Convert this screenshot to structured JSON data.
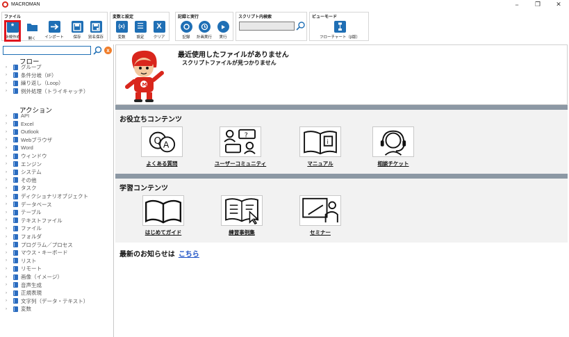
{
  "window": {
    "title": "MACROMAN",
    "buttons": {
      "minimize": "−",
      "maximize": "❐",
      "close": "✕"
    }
  },
  "ribbon": {
    "file_group": {
      "label": "ファイル",
      "buttons": [
        "新規作成",
        "開く",
        "インポート",
        "保存",
        "別名保存"
      ]
    },
    "vars_group": {
      "label": "変数と設定",
      "buttons": [
        "変数",
        "設定",
        "クリア"
      ]
    },
    "record_group": {
      "label": "記録と実行",
      "buttons": [
        "記録",
        "計画実行",
        "実行"
      ]
    },
    "search_group": {
      "label": "スクリプト内検索",
      "value": ""
    },
    "view_group": {
      "label": "ビューモード",
      "button": "フローチャート（β版）"
    },
    "icons": {
      "new": "*",
      "vars": "{x}",
      "settings": "☰",
      "clear": "X"
    }
  },
  "tree": {
    "search_value": "",
    "clear_icon": "x",
    "flow_title": "フロー",
    "flow_items": [
      "グループ",
      "条件分岐（IF）",
      "繰り返し（Loop）",
      "例外処理（トライキャッチ）"
    ],
    "action_title": "アクション",
    "action_items": [
      "API",
      "Excel",
      "Outlook",
      "Webブラウザ",
      "Word",
      "ウィンドウ",
      "エンジン",
      "システム",
      "その他",
      "タスク",
      "ディクショナリオブジェクト",
      "データベース",
      "テーブル",
      "テキストファイル",
      "ファイル",
      "フォルダ",
      "プログラム／プロセス",
      "マウス・キーボード",
      "リスト",
      "リモート",
      "画像（イメージ）",
      "音声生成",
      "正規表現",
      "文字列（データ・テキスト）",
      "変数"
    ]
  },
  "recent": {
    "title": "最近使用したファイルがありません",
    "subtitle": "スクリプトファイルが見つかりません"
  },
  "useful": {
    "title": "お役立ちコンテンツ",
    "tiles": [
      "よくある質問",
      "ユーザーコミュニティ",
      "マニュアル",
      "相談チケット"
    ]
  },
  "learning": {
    "title": "学習コンテンツ",
    "tiles": [
      "はじめてガイド",
      "練習事例集",
      "セミナー"
    ]
  },
  "news": {
    "label": "最新のお知らせは",
    "link": "こちら"
  },
  "colors": {
    "accent": "#1f6fb5",
    "highlight": "#e0141e",
    "divider": "#8c98a4",
    "link": "#1a4fc4",
    "mascot": "#d9261c"
  }
}
